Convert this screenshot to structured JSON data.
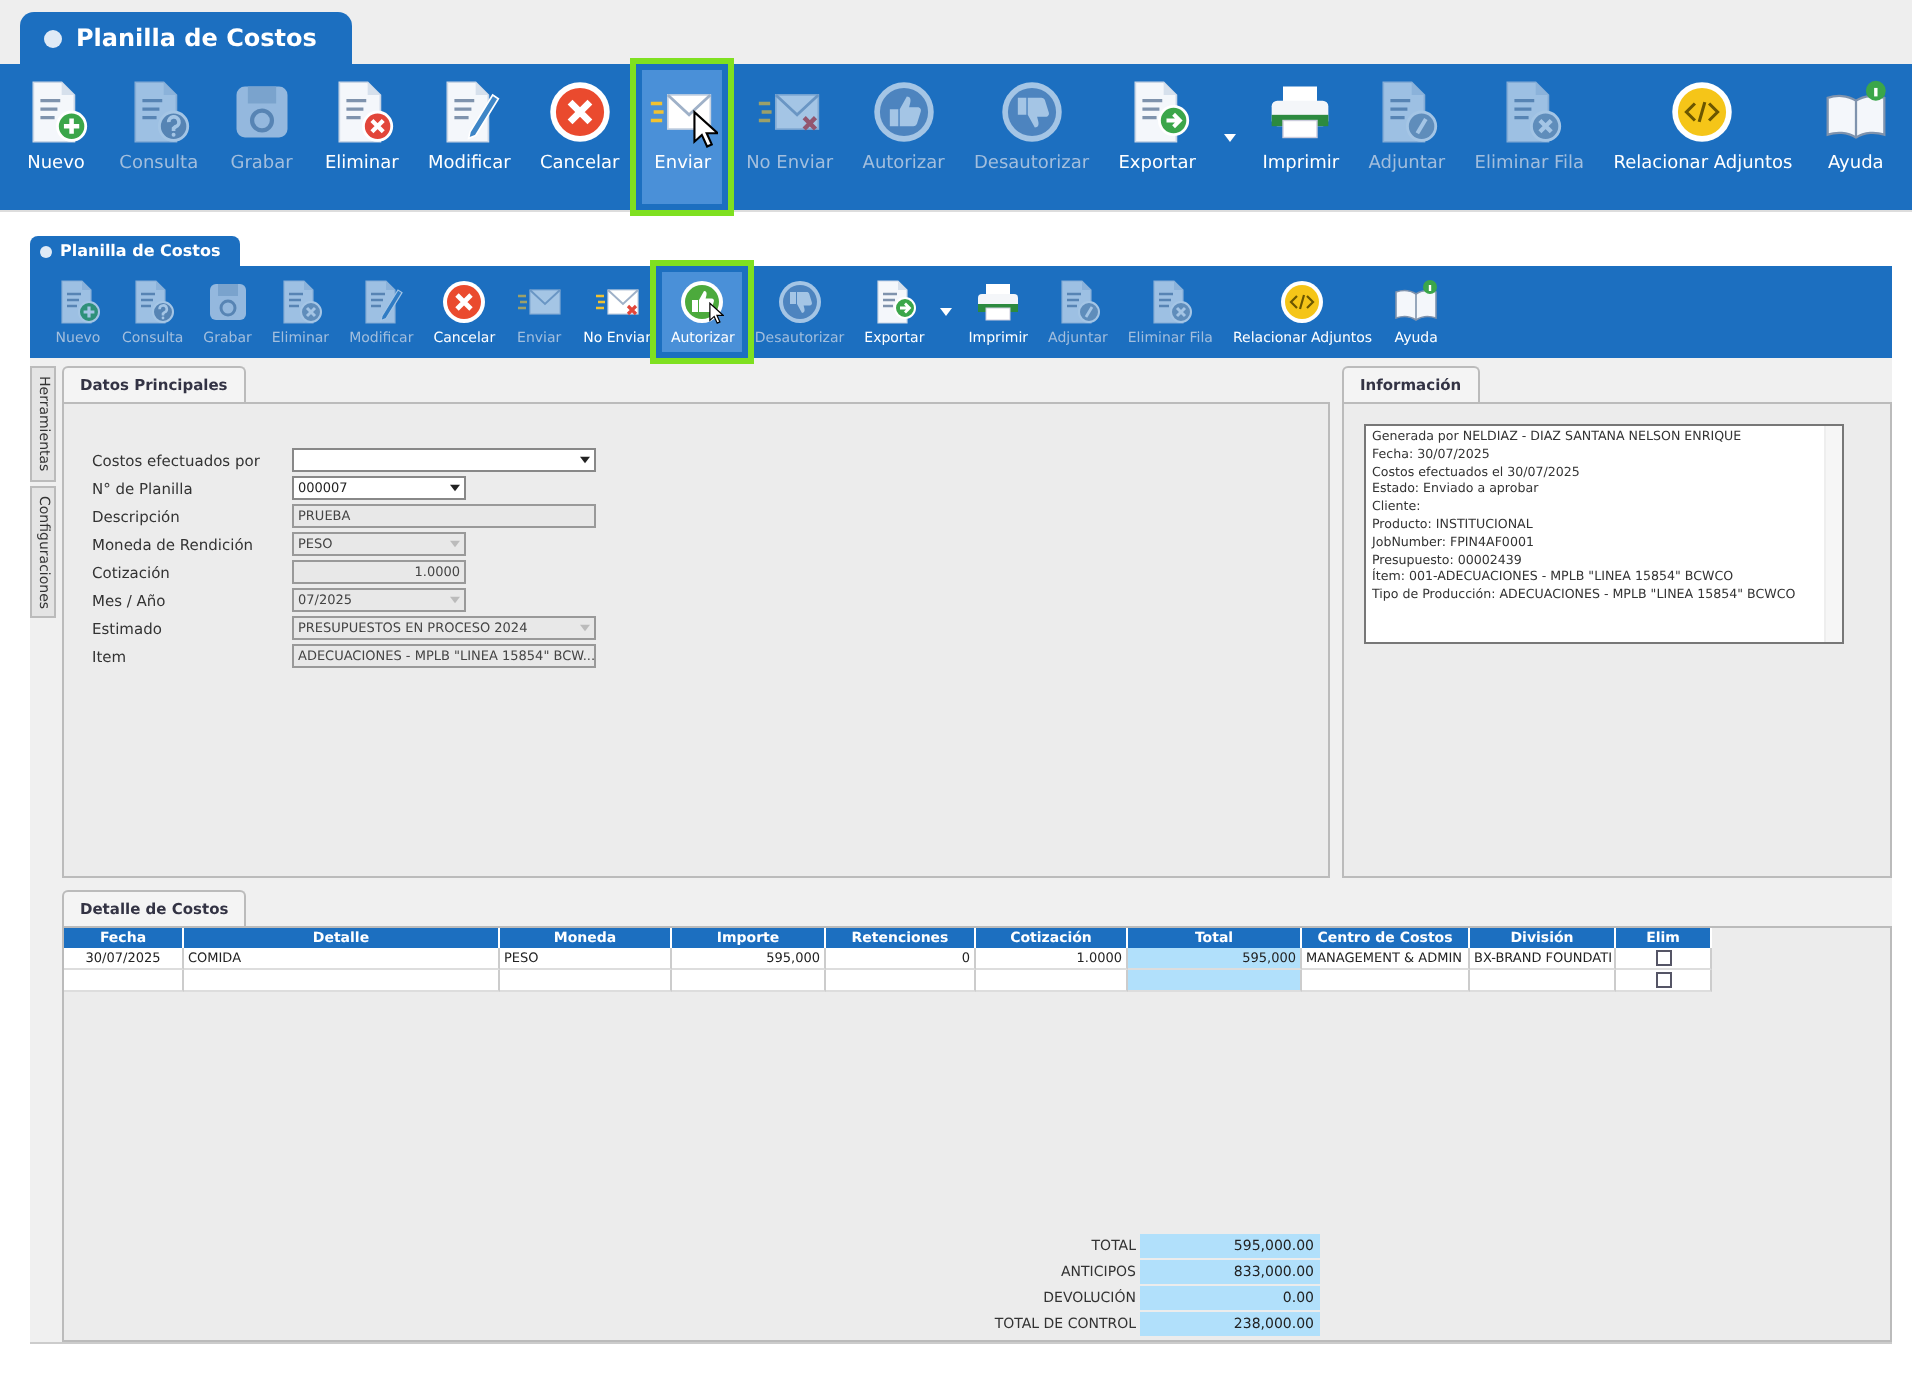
{
  "overlay": {
    "title": "Planilla de Costos",
    "toolbar": [
      {
        "label": "Nuevo",
        "kind": "doc-plus",
        "enabled": true,
        "selected": false
      },
      {
        "label": "Consulta",
        "kind": "doc-question",
        "enabled": false,
        "selected": false
      },
      {
        "label": "Grabar",
        "kind": "floppy",
        "enabled": false,
        "selected": false
      },
      {
        "label": "Eliminar",
        "kind": "doc-x",
        "enabled": true,
        "selected": false
      },
      {
        "label": "Modificar",
        "kind": "doc-pencil",
        "enabled": true,
        "selected": false
      },
      {
        "label": "Cancelar",
        "kind": "cancel",
        "enabled": true,
        "selected": false
      },
      {
        "label": "Enviar",
        "kind": "envelope",
        "enabled": true,
        "selected": true
      },
      {
        "label": "No Enviar",
        "kind": "envelope-x",
        "enabled": false,
        "selected": false
      },
      {
        "label": "Autorizar",
        "kind": "thumb-up",
        "enabled": false,
        "selected": false
      },
      {
        "label": "Desautorizar",
        "kind": "thumb-down",
        "enabled": false,
        "selected": false
      },
      {
        "label": "Exportar",
        "kind": "doc-arrow",
        "enabled": true,
        "selected": false,
        "dropdown": true
      },
      {
        "label": "Imprimir",
        "kind": "printer",
        "enabled": true,
        "selected": false
      },
      {
        "label": "Adjuntar",
        "kind": "doc-clip",
        "enabled": false,
        "selected": false
      },
      {
        "label": "Eliminar Fila",
        "kind": "doc-x",
        "enabled": false,
        "selected": false
      },
      {
        "label": "Relacionar Adjuntos",
        "kind": "code",
        "enabled": true,
        "selected": false
      },
      {
        "label": "Ayuda",
        "kind": "book",
        "enabled": true,
        "selected": false
      }
    ]
  },
  "window": {
    "title": "Planilla de Costos",
    "toolbar": [
      {
        "label": "Nuevo",
        "kind": "doc-plus",
        "enabled": false,
        "selected": false
      },
      {
        "label": "Consulta",
        "kind": "doc-question",
        "enabled": false,
        "selected": false
      },
      {
        "label": "Grabar",
        "kind": "floppy",
        "enabled": false,
        "selected": false
      },
      {
        "label": "Eliminar",
        "kind": "doc-x",
        "enabled": false,
        "selected": false
      },
      {
        "label": "Modificar",
        "kind": "doc-pencil",
        "enabled": false,
        "selected": false
      },
      {
        "label": "Cancelar",
        "kind": "cancel",
        "enabled": true,
        "selected": false
      },
      {
        "label": "Enviar",
        "kind": "envelope",
        "enabled": false,
        "selected": false
      },
      {
        "label": "No Enviar",
        "kind": "envelope-x",
        "enabled": true,
        "selected": false
      },
      {
        "label": "Autorizar",
        "kind": "thumb-up",
        "enabled": true,
        "selected": true
      },
      {
        "label": "Desautorizar",
        "kind": "thumb-down",
        "enabled": false,
        "selected": false
      },
      {
        "label": "Exportar",
        "kind": "doc-arrow",
        "enabled": true,
        "selected": false,
        "dropdown": true
      },
      {
        "label": "Imprimir",
        "kind": "printer",
        "enabled": true,
        "selected": false
      },
      {
        "label": "Adjuntar",
        "kind": "doc-clip",
        "enabled": false,
        "selected": false
      },
      {
        "label": "Eliminar Fila",
        "kind": "doc-x",
        "enabled": false,
        "selected": false
      },
      {
        "label": "Relacionar Adjuntos",
        "kind": "code",
        "enabled": true,
        "selected": false
      },
      {
        "label": "Ayuda",
        "kind": "book",
        "enabled": true,
        "selected": false
      }
    ],
    "side_tabs": [
      "Herramientas",
      "Configuraciones"
    ],
    "main_panel": {
      "tab": "Datos Principales",
      "fields": [
        {
          "label": "Costos efectuados por",
          "kind": "dropdown",
          "editable": true
        },
        {
          "label": "N° de Planilla",
          "kind": "dropdown",
          "editable": true,
          "value": "000007"
        },
        {
          "label": "Descripción",
          "kind": "text",
          "editable": false,
          "value": "PRUEBA"
        },
        {
          "label": "Moneda de Rendición",
          "kind": "dropdown",
          "editable": false,
          "value": "PESO"
        },
        {
          "label": "Cotización",
          "kind": "number",
          "editable": false,
          "value": "1.0000"
        },
        {
          "label": "Mes / Año",
          "kind": "dropdown",
          "editable": false,
          "value": "07/2025"
        },
        {
          "label": "Estimado",
          "kind": "dropdown",
          "editable": false,
          "value": "PRESUPUESTOS EN PROCESO 2024"
        },
        {
          "label": "Item",
          "kind": "dropdown",
          "editable": false,
          "value": "ADECUACIONES   - MPLB \"LINEA 15854\" BCW..."
        }
      ]
    },
    "info_panel": {
      "tab": "Información",
      "lines": [
        "Generada por NELDIAZ  - DIAZ SANTANA NELSON ENRIQUE",
        "Fecha: 30/07/2025",
        "Costos efectuados el 30/07/2025",
        "Estado: Enviado a aprobar",
        "Cliente:",
        "Producto: INSTITUCIONAL",
        "JobNumber: FPIN4AF0001",
        "Presupuesto: 00002439",
        "Ítem: 001-ADECUACIONES   - MPLB \"LINEA 15854\" BCWCO",
        "Tipo de Producción: ADECUACIONES   - MPLB \"LINEA 15854\" BCWCO"
      ]
    },
    "detail": {
      "tab": "Detalle de Costos",
      "table": {
        "columns": [
          "Fecha",
          "Detalle",
          "Moneda",
          "Importe",
          "Retenciones",
          "Cotización",
          "Total",
          "Centro de Costos",
          "División",
          "Elim"
        ],
        "rows": [
          {
            "cells": [
              "30/07/2025",
              "COMIDA",
              "PESO",
              "595,000",
              "0",
              "1.0000",
              "595,000",
              "MANAGEMENT & ADMIN",
              "BX-BRAND FOUNDATI"
            ],
            "elim": false
          },
          {
            "elim": false
          }
        ]
      },
      "totals": [
        {
          "label": "TOTAL",
          "value": "595,000.00"
        },
        {
          "label": "ANTICIPOS",
          "value": "833,000.00"
        },
        {
          "label": "DEVOLUCIÓN",
          "value": "0.00"
        },
        {
          "label": "TOTAL DE CONTROL",
          "value": "238,000.00"
        }
      ]
    }
  }
}
